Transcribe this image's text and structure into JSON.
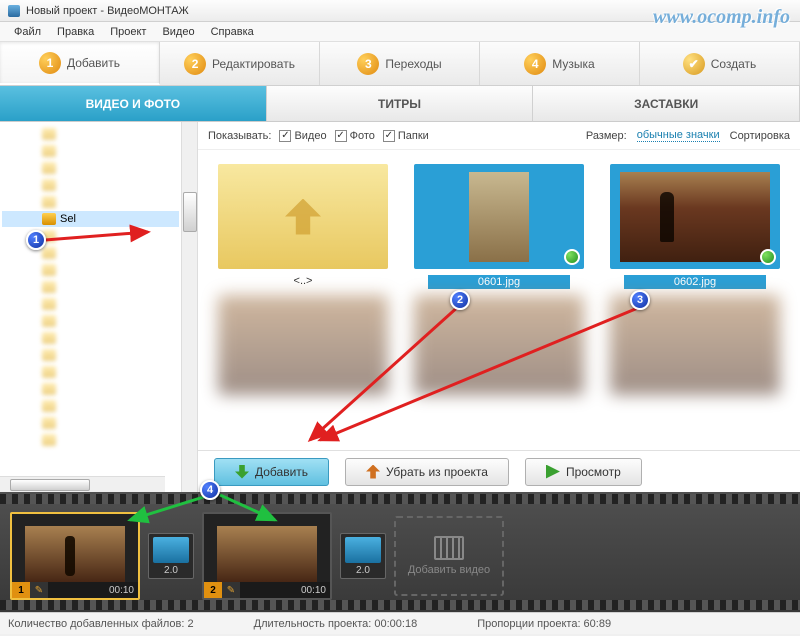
{
  "window": {
    "title": "Новый проект - ВидеоМОНТАЖ"
  },
  "menu": {
    "file": "Файл",
    "edit": "Правка",
    "project": "Проект",
    "video": "Видео",
    "help": "Справка"
  },
  "steps": {
    "s1": "Добавить",
    "s2": "Редактировать",
    "s3": "Переходы",
    "s4": "Музыка",
    "s5": "Создать",
    "n1": "1",
    "n2": "2",
    "n3": "3",
    "n4": "4",
    "n5": "✔"
  },
  "subtabs": {
    "media": "ВИДЕО И ФОТО",
    "titles": "ТИТРЫ",
    "intros": "ЗАСТАВКИ"
  },
  "filter": {
    "show_label": "Показывать:",
    "video": "Видео",
    "photo": "Фото",
    "folders": "Папки",
    "size_label": "Размер:",
    "size_value": "обычные значки",
    "sort": "Сортировка"
  },
  "tree": {
    "selected": "Sel"
  },
  "thumbs": {
    "up": "<..>",
    "f1": "0601.jpg",
    "f2": "0602.jpg"
  },
  "actions": {
    "add": "Добавить",
    "remove": "Убрать из проекта",
    "preview": "Просмотр"
  },
  "timeline": {
    "clip1_idx": "1",
    "clip1_time": "00:10",
    "clip2_idx": "2",
    "clip2_time": "00:10",
    "trans": "2.0",
    "addvideo": "Добавить видео"
  },
  "status": {
    "files": "Количество добавленных файлов: 2",
    "duration": "Длительность проекта:   00:00:18",
    "ratio": "Пропорции проекта:  60:89"
  },
  "markers": {
    "m1": "1",
    "m2": "2",
    "m3": "3",
    "m4": "4"
  },
  "watermark": "www.ocomp.info"
}
